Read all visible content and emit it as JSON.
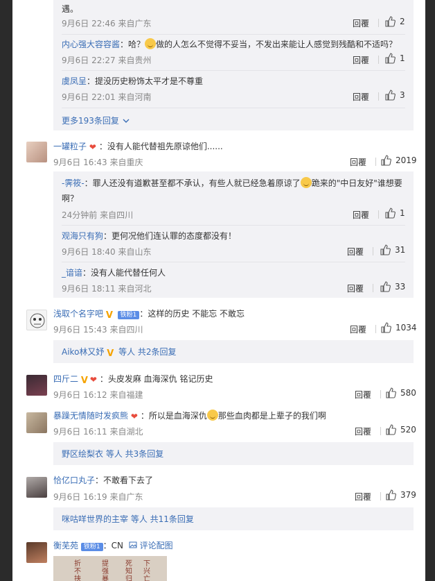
{
  "reply_group_1": {
    "first_tail": {
      "text": "遇。",
      "time": "9月6日 22:46",
      "location": "来自广东",
      "reply_label": "回覆",
      "likes": "2"
    },
    "replies": [
      {
        "user": "内心强大容容酱",
        "text": "：哈？",
        "text_after_emoji": "做的人怎么不觉得不妥当，不发出来能让人感觉到残酷和不适吗？",
        "time": "9月6日 22:27",
        "location": "来自贵州",
        "reply_label": "回覆",
        "likes": "1"
      },
      {
        "user": "虞凤呈",
        "text": "：提没历史粉饰太平才是不尊重",
        "time": "9月6日 22:01",
        "location": "来自河南",
        "reply_label": "回覆",
        "likes": "3"
      }
    ],
    "more": "更多193条回复"
  },
  "comment_1": {
    "user": "一罐粒子",
    "text": "：没有人能代替祖先原谅他们......",
    "time": "9月6日 16:43",
    "location": "来自重庆",
    "reply_label": "回覆",
    "likes": "2019",
    "replies": [
      {
        "user": "-霁筱-",
        "text": "：罪人还没有道歉甚至都不承认，有些人就已经急着原谅了",
        "text_after_emoji": "跪来的\"中日友好\"谁想要",
        "text_line2": "啊？",
        "time": "24分钟前",
        "location": "来自四川",
        "reply_label": "回覆",
        "likes": "1"
      },
      {
        "user": "观海只有狗",
        "text": "：更何况他们连认罪的态度都没有！",
        "time": "9月6日 18:40",
        "location": "来自山东",
        "reply_label": "回覆",
        "likes": "31"
      },
      {
        "user": "_谙谙",
        "text": "：没有人能代替任何人",
        "time": "9月6日 18:11",
        "location": "来自河北",
        "reply_label": "回覆",
        "likes": "33"
      }
    ]
  },
  "comment_2": {
    "user": "浅取个名字吧",
    "fan_badge": "铁粉1",
    "text": "：这样的历史 不能忘 不敢忘",
    "time": "9月6日 15:43",
    "location": "来自四川",
    "reply_label": "回覆",
    "likes": "1034",
    "summary_user": "Aiko林又妤",
    "summary_rest": "等人 共2条回复"
  },
  "comment_3": {
    "user": "四斤二",
    "text": "：头皮发麻 血海深仇 铭记历史",
    "time": "9月6日 16:12",
    "location": "来自福建",
    "reply_label": "回覆",
    "likes": "580"
  },
  "comment_4": {
    "user": "暴躁无情随时发疯熊",
    "text": "：所以是血海深仇",
    "text_after_emoji": "那些血肉都是上辈子的我们啊",
    "time": "9月6日 16:11",
    "location": "来自湖北",
    "reply_label": "回覆",
    "likes": "520",
    "summary_user": "野区绘梨衣",
    "summary_rest": "等人 共3条回复"
  },
  "comment_5": {
    "user": "恰亿口丸子",
    "text": "：不敢看下去了",
    "time": "9月6日 16:19",
    "location": "来自广东",
    "reply_label": "回覆",
    "likes": "379",
    "summary_user": "咪咕咩世界的主宰",
    "summary_rest": "等人 共11条回复"
  },
  "comment_6": {
    "user": "衡芜苑",
    "fan_badge": "铁粉1",
    "text": "：CN",
    "pic_label": "评论配图",
    "image_chars": [
      "折",
      "提",
      "死",
      "下",
      "不",
      "强",
      "知",
      "兴",
      "挟",
      "暴",
      "归",
      "亡"
    ]
  },
  "colors": {
    "accent_orange": "#eb7350",
    "link_blue": "#3a6db5",
    "reply_bg": "#f2f2f5"
  }
}
